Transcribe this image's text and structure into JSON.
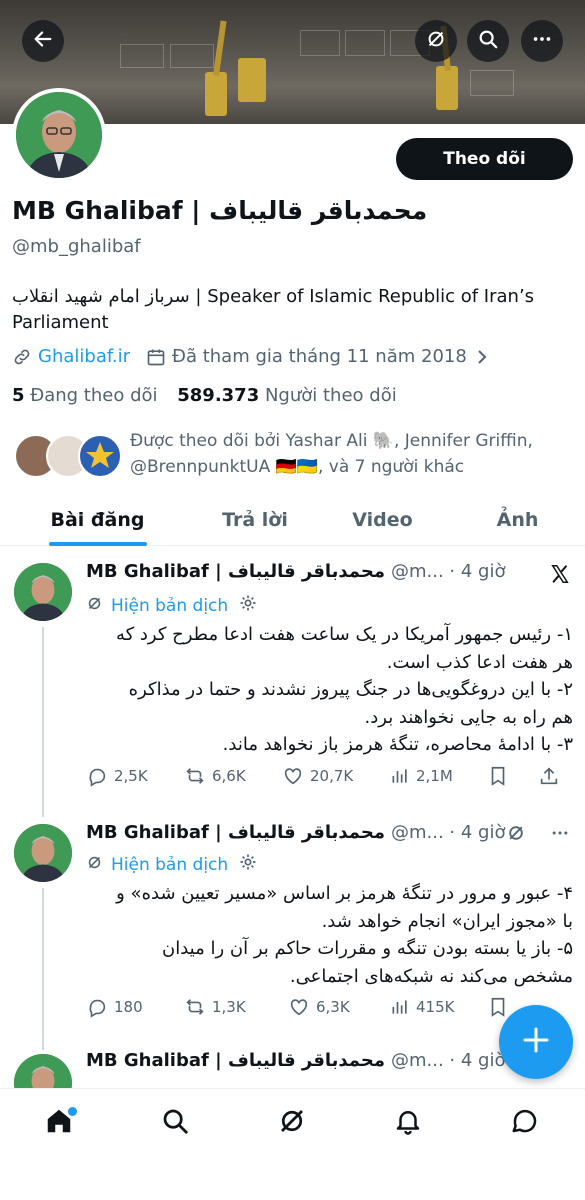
{
  "header": {
    "back_icon": "arrow-left-icon",
    "grok_icon": "grok-icon",
    "search_icon": "search-icon",
    "more_icon": "more-horizontal-icon"
  },
  "profile": {
    "name": "MB Ghalibaf | محمدباقر قالیباف",
    "handle": "@mb_ghalibaf",
    "follow_label": "Theo dõi",
    "bio_rtl": "سرباز امام شهید انقلاب",
    "bio_ltr": " | Speaker of Islamic Republic of Iran’s Parliament",
    "website": "Ghalibaf.ir",
    "joined": "Đã tham gia tháng 11 năm 2018",
    "following_count": "5",
    "following_label": "Đang theo dõi",
    "followers_count": "589.373",
    "followers_label": "Người theo dõi",
    "followed_by": "Được theo dõi bởi Yashar Ali 🐘, Jennifer Griffin, @BrennpunktUA 🇩🇪🇺🇦, và 7 người khác"
  },
  "tabs": [
    {
      "label": "Bài đăng",
      "active": true
    },
    {
      "label": "Trả lời",
      "active": false
    },
    {
      "label": "Video",
      "active": false
    },
    {
      "label": "Ảnh",
      "active": false
    }
  ],
  "tweets": [
    {
      "name": "MB Ghalibaf | محمدباقر قالیباف",
      "meta": "@m... · 4 giờ",
      "translate_label": "Hiện bản dịch",
      "lines": [
        "۱- رئیس جمهور آمریکا در یک ساعت هفت ادعا مطرح کرد که",
        "هر هفت ادعا کذب است.",
        "۲- با این دروغگویی‌ها در جنگ پیروز نشدند و حتما در مذاکره",
        "هم راه به جایی نخواهند برد.",
        "۳- با ادامهٔ محاصره، تنگهٔ هرمز باز نخواهد ماند."
      ],
      "replies": "2,5K",
      "reposts": "6,6K",
      "likes": "20,7K",
      "views": "2,1M"
    },
    {
      "name": "MB Ghalibaf | محمدباقر قالیباف",
      "meta": "@m... · 4 giờ",
      "translate_label": "Hiện bản dịch",
      "lines": [
        "۴- عبور و مرور در تنگهٔ هرمز بر اساس «مسیر تعیین شده» و",
        "با «مجوز ایران» انجام خواهد شد.",
        "۵- باز یا بسته بودن تنگه و مقررات حاکم بر آن را میدان",
        "مشخص می‌کند نه شبکه‌های اجتماعی."
      ],
      "replies": "180",
      "reposts": "1,3K",
      "likes": "6,3K",
      "views": "415K"
    },
    {
      "name": "MB Ghalibaf | محمدباقر قالیباف",
      "meta": "@m... · 4 giờ"
    }
  ],
  "bottom_nav": [
    "home-icon",
    "search-icon",
    "grok-icon",
    "notifications-icon",
    "messages-icon"
  ],
  "colors": {
    "accent": "#1d9bf0",
    "text": "#0f1419",
    "muted": "#536471"
  }
}
